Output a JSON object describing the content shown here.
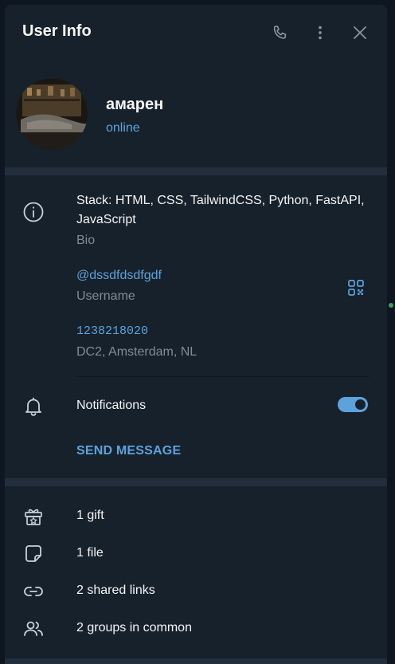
{
  "header": {
    "title": "User Info",
    "icons": [
      "phone-icon",
      "more-vertical-icon",
      "close-icon"
    ]
  },
  "profile": {
    "name": "амарен",
    "status": "online"
  },
  "info": {
    "bio": "Stack: HTML, CSS, TailwindCSS, Python, FastAPI, JavaScript",
    "bio_label": "Bio",
    "username": "@dssdfdsdfgdf",
    "username_label": "Username",
    "phone": "1238218020",
    "dc": "DC2, Amsterdam, NL"
  },
  "notifications": {
    "label": "Notifications",
    "enabled": true
  },
  "send_message_label": "SEND MESSAGE",
  "media": [
    {
      "icon": "gift-icon",
      "label": "1 gift"
    },
    {
      "icon": "file-icon",
      "label": "1 file"
    },
    {
      "icon": "link-icon",
      "label": "2 shared links"
    },
    {
      "icon": "groups-icon",
      "label": "2 groups in common"
    }
  ],
  "colors": {
    "panel_bg": "#17212b",
    "separator": "#232e3c",
    "accent": "#5ea2dc",
    "secondary_text": "#7f8b96"
  }
}
